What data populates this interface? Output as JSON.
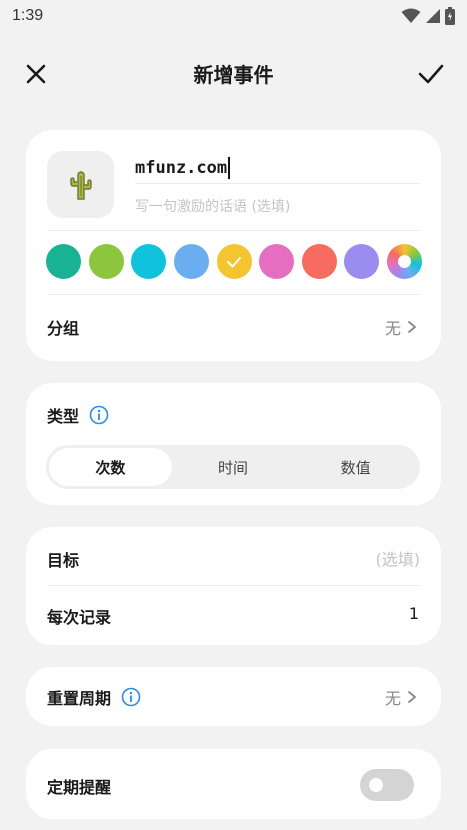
{
  "status_bar": {
    "time": "1:39"
  },
  "header": {
    "title": "新增事件"
  },
  "event": {
    "name_value": "mfunz.com",
    "motto_placeholder": "写一句激励的话语 (选填)",
    "colors": [
      "#19b394",
      "#8cc63f",
      "#10c2dc",
      "#6aaef0",
      "#f5c431",
      "#e66ec0",
      "#f76b61",
      "#9b8cef",
      "rainbow"
    ],
    "selected_color_index": 4
  },
  "group": {
    "label": "分组",
    "value": "无"
  },
  "type": {
    "label": "类型",
    "options": [
      "次数",
      "时间",
      "数值"
    ],
    "selected_index": 0
  },
  "target": {
    "label": "目标",
    "placeholder": "(选填)"
  },
  "per_record": {
    "label": "每次记录",
    "value": "1"
  },
  "reset_cycle": {
    "label": "重置周期",
    "value": "无"
  },
  "reminder": {
    "label": "定期提醒",
    "enabled": false
  },
  "icons": {
    "close": "close-icon",
    "confirm": "checkmark-icon",
    "event_icon": "cactus-icon",
    "info": "info-icon",
    "chevron": "chevron-right-icon"
  }
}
